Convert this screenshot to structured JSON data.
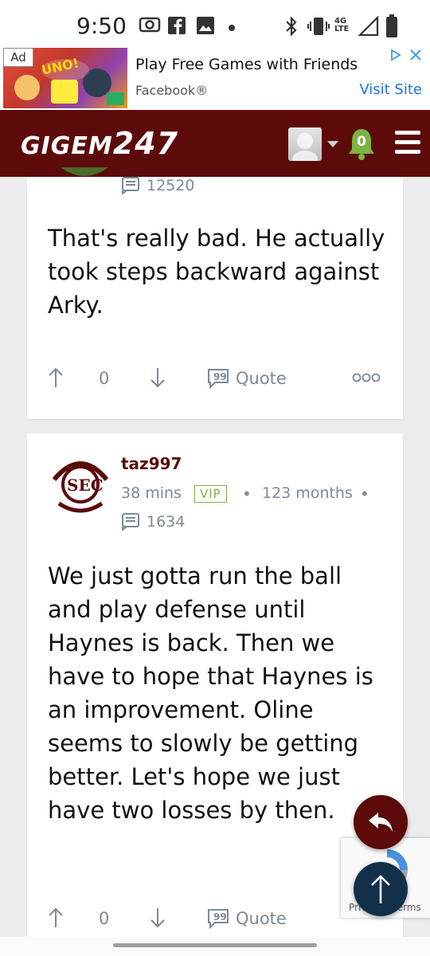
{
  "status_bar": {
    "time": "9:50",
    "icons": [
      "camera-icon",
      "facebook-icon",
      "gallery-icon",
      "dot-icon",
      "bluetooth-icon",
      "vibrate-icon",
      "network-4g-lte-icon",
      "signal-icon",
      "battery-icon"
    ],
    "network": "4G LTE"
  },
  "ad": {
    "label": "Ad",
    "title": "Play Free Games with Friends",
    "sponsor": "Facebook®",
    "cta": "Visit Site",
    "image_text": "UNO!"
  },
  "header": {
    "logo_text": "GIGEM",
    "logo_number": "247",
    "notification_count": "0",
    "accent_color": "#5c0a0a",
    "bell_color": "#7cb342"
  },
  "posts": [
    {
      "post_count": "12520",
      "body": "That's really bad. He actually took steps backward against Arky.",
      "upvotes": "0",
      "quote_label": "Quote"
    },
    {
      "username": "taz997",
      "time_ago": "38 mins",
      "badge": "VIP",
      "tenure": "123 months",
      "post_count": "1634",
      "body": "We just gotta run the ball and play defense until Haynes is back. Then we have to hope that Haynes is an improvement. Oline seems to slowly be getting better. Let's hope we just have two losses by then.",
      "upvotes": "0",
      "quote_label": "Quote"
    }
  ],
  "recaptcha": {
    "text": "Privacy - Terms"
  }
}
